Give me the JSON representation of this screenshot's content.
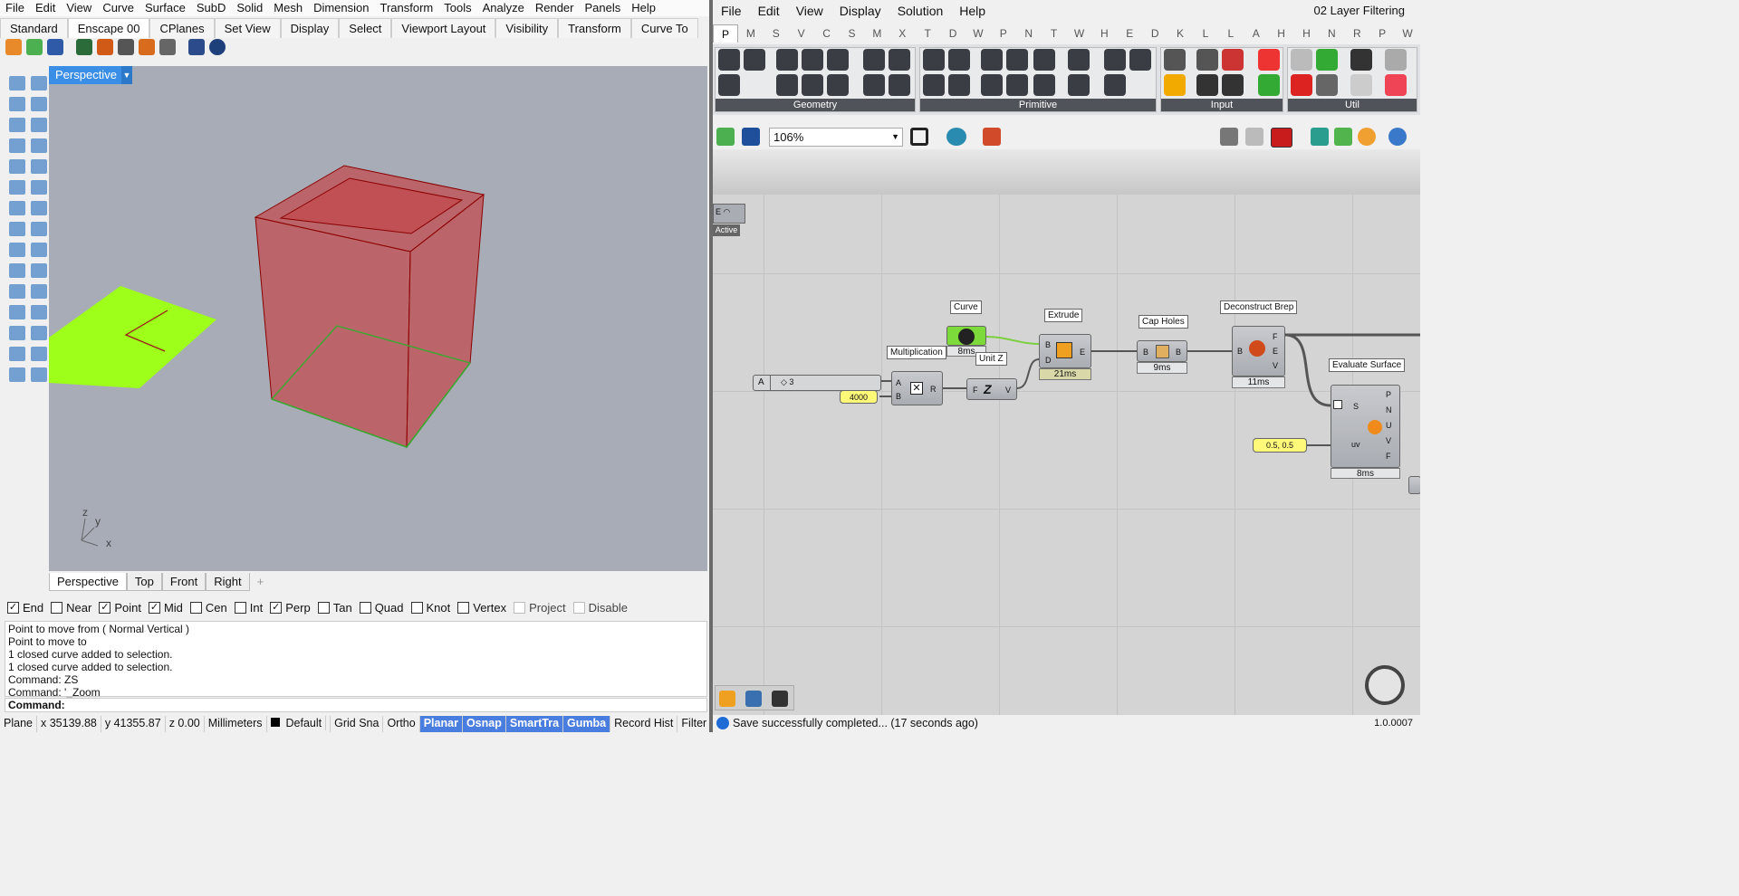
{
  "rhino": {
    "menu": [
      "File",
      "Edit",
      "View",
      "Curve",
      "Surface",
      "SubD",
      "Solid",
      "Mesh",
      "Dimension",
      "Transform",
      "Tools",
      "Analyze",
      "Render",
      "Panels",
      "Help"
    ],
    "toolbar_tabs": [
      "Standard",
      "Enscape 00",
      "CPlanes",
      "Set View",
      "Display",
      "Select",
      "Viewport Layout",
      "Visibility",
      "Transform",
      "Curve To"
    ],
    "active_toolbar_tab": "Enscape 00",
    "viewport_title": "Perspective",
    "viewport_tabs": [
      "Perspective",
      "Top",
      "Front",
      "Right"
    ],
    "osnaps": [
      {
        "label": "End",
        "checked": true
      },
      {
        "label": "Near",
        "checked": false
      },
      {
        "label": "Point",
        "checked": true
      },
      {
        "label": "Mid",
        "checked": true
      },
      {
        "label": "Cen",
        "checked": false
      },
      {
        "label": "Int",
        "checked": false
      },
      {
        "label": "Perp",
        "checked": true
      },
      {
        "label": "Tan",
        "checked": false
      },
      {
        "label": "Quad",
        "checked": false
      },
      {
        "label": "Knot",
        "checked": false
      },
      {
        "label": "Vertex",
        "checked": false
      },
      {
        "label": "Project",
        "checked": false,
        "disabled": true
      },
      {
        "label": "Disable",
        "checked": false,
        "disabled": true
      }
    ],
    "command_history": [
      "Point to move from ( Normal  Vertical )",
      "Point to move to",
      "1 closed curve added to selection.",
      "1 closed curve added to selection.",
      "Command: ZS",
      "Command: '_Zoom"
    ],
    "command_prompt": "Command:",
    "status_bar": {
      "cplane": "Plane",
      "x": "x 35139.88",
      "y": "y 41355.87",
      "z": "z 0.00",
      "units": "Millimeters",
      "layer": "Default",
      "grid": "Grid Sna",
      "ortho": "Ortho",
      "planar": "Planar",
      "osnap": "Osnap",
      "smarttrack": "SmartTra",
      "gumball": "Gumba",
      "record": "Record Hist",
      "filter": "Filter"
    },
    "axis_labels": {
      "x": "x",
      "y": "y",
      "z": "z"
    },
    "colors": {
      "viewport_bg": "#a7acb6",
      "box_fill": "#cc2b2b",
      "box_edge": "#8a0000",
      "plane": "#9dff1a",
      "accent": "#3b8ee6"
    }
  },
  "grasshopper": {
    "menu": [
      "File",
      "Edit",
      "View",
      "Display",
      "Solution",
      "Help"
    ],
    "doc_title": "02 Layer Filtering",
    "categories": [
      "P",
      "M",
      "S",
      "V",
      "C",
      "S",
      "M",
      "X",
      "T",
      "D",
      "W",
      "P",
      "N",
      "T",
      "W",
      "H",
      "E",
      "D",
      "K",
      "L",
      "L",
      "A",
      "H",
      "H",
      "N",
      "R",
      "P",
      "W"
    ],
    "active_category": "P",
    "panels": [
      "Geometry",
      "Primitive",
      "Input",
      "Util"
    ],
    "zoom": "106%",
    "canvas": {
      "active_tag": "Active",
      "active_tag_letter": "E",
      "components": [
        {
          "name": "Curve",
          "time": "8ms"
        },
        {
          "name": "Multiplication",
          "inputs": [
            "A",
            "B"
          ],
          "outputs": [
            "R"
          ]
        },
        {
          "name": "Unit Z",
          "inputs": [
            "F"
          ],
          "outputs": [
            "V"
          ]
        },
        {
          "name": "Extrude",
          "inputs": [
            "B",
            "D"
          ],
          "outputs": [
            "E"
          ],
          "time": "21ms"
        },
        {
          "name": "Cap Holes",
          "inputs": [
            "B"
          ],
          "outputs": [
            "B"
          ],
          "time": "9ms"
        },
        {
          "name": "Deconstruct Brep",
          "inputs": [
            "B"
          ],
          "outputs": [
            "F",
            "E",
            "V"
          ],
          "time": "11ms"
        },
        {
          "name": "Evaluate Surface",
          "inputs": [
            "S",
            "uv"
          ],
          "outputs": [
            "P",
            "N",
            "U",
            "V",
            "F"
          ],
          "time": "8ms"
        }
      ],
      "slider": {
        "label": "A",
        "value": "3"
      },
      "panel_value": "4000",
      "uv_value": "0.5, 0.5"
    },
    "status": "Save successfully completed... (17 seconds ago)",
    "version": "1.0.0007"
  }
}
